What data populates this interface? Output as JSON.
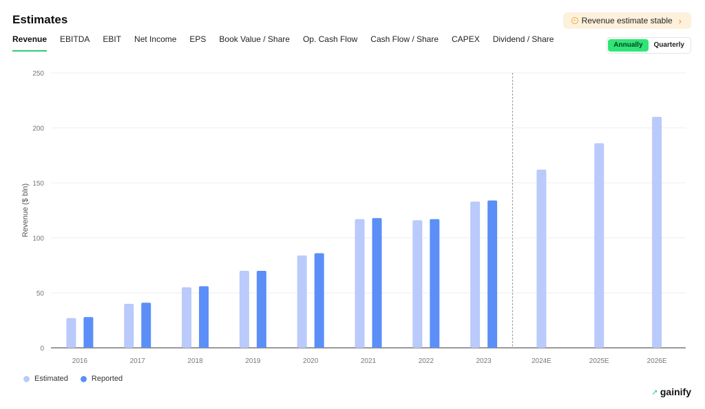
{
  "header": {
    "title": "Estimates",
    "badge_label": "Revenue estimate stable",
    "badge_chevron": "›"
  },
  "tabs": [
    {
      "label": "Revenue",
      "active": true
    },
    {
      "label": "EBITDA"
    },
    {
      "label": "EBIT"
    },
    {
      "label": "Net Income"
    },
    {
      "label": "EPS"
    },
    {
      "label": "Book Value / Share"
    },
    {
      "label": "Op. Cash Flow"
    },
    {
      "label": "Cash Flow / Share"
    },
    {
      "label": "CAPEX"
    },
    {
      "label": "Dividend / Share"
    }
  ],
  "period_toggle": {
    "options": [
      "Annually",
      "Quarterly"
    ],
    "selected": "Annually"
  },
  "brand": {
    "name": "gainify",
    "icon": "arrow-up-right-icon"
  },
  "colors": {
    "estimated": "#b9cafb",
    "reported": "#5b8ff7",
    "accent": "#2ee676",
    "divider": "#9a9a9a"
  },
  "chart_data": {
    "type": "bar",
    "title": "",
    "xlabel": "",
    "ylabel": "Revenue ($ bln)",
    "ylim": [
      0,
      250
    ],
    "yticks": [
      0,
      50,
      100,
      150,
      200,
      250
    ],
    "grid": true,
    "legend_position": "bottom-left",
    "forecast_divider_after": "2023",
    "categories": [
      "2016",
      "2017",
      "2018",
      "2019",
      "2020",
      "2021",
      "2022",
      "2023",
      "2024E",
      "2025E",
      "2026E"
    ],
    "series": [
      {
        "name": "Estimated",
        "values": [
          27,
          40,
          55,
          70,
          84,
          117,
          116,
          133,
          162,
          186,
          210
        ]
      },
      {
        "name": "Reported",
        "values": [
          28,
          41,
          56,
          70,
          86,
          118,
          117,
          134,
          null,
          null,
          null
        ]
      }
    ]
  }
}
